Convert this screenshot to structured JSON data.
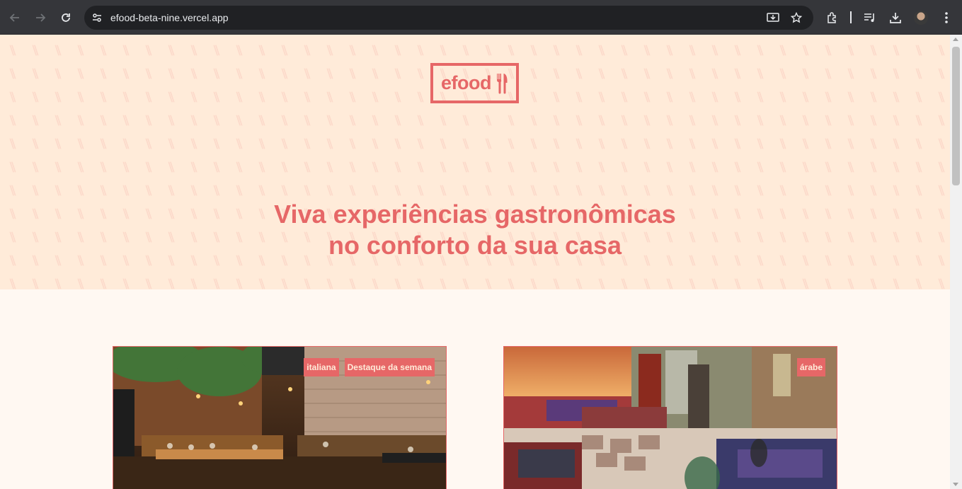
{
  "browser": {
    "url": "efood-beta-nine.vercel.app",
    "icons": [
      "back-icon",
      "forward-icon",
      "reload-icon",
      "site-info-icon",
      "install-app-icon",
      "bookmark-star-icon",
      "extensions-icon",
      "media-controls-icon",
      "downloads-icon",
      "profile-avatar",
      "kebab-menu-icon"
    ]
  },
  "hero": {
    "logo_text": "efood",
    "title_line1": "Viva experiências gastronômicas",
    "title_line2": "no conforto da sua casa"
  },
  "restaurants": [
    {
      "tags": [
        "italiana",
        "Destaque da semana"
      ],
      "image": "italian-restaurant-interior"
    },
    {
      "tags": [
        "árabe"
      ],
      "image": "arabic-restaurant-interior"
    }
  ],
  "colors": {
    "accent": "#e66767",
    "hero_bg": "#ffebd9",
    "page_bg": "#fff8f2"
  }
}
